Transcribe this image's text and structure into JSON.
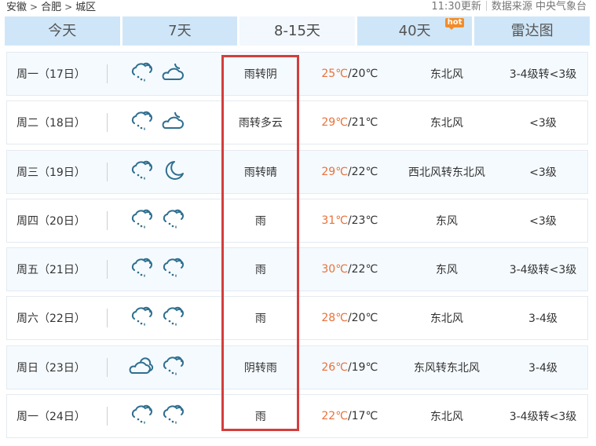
{
  "breadcrumb": {
    "items": [
      "安徽",
      "合肥",
      "城区"
    ],
    "separator": ">"
  },
  "meta": {
    "update_time": "11:30更新",
    "source": "数据来源 中央气象台"
  },
  "tabs": [
    {
      "label": "今天",
      "active": false
    },
    {
      "label": "7天",
      "active": false
    },
    {
      "label": "8-15天",
      "active": true
    },
    {
      "label": "40天",
      "active": false,
      "badge": "hot"
    },
    {
      "label": "雷达图",
      "active": false
    }
  ],
  "colors": {
    "tab_bg": "#cfe6f8",
    "tab_active_bg": "#f2f8fd",
    "high_temp": "#e8713a",
    "icon": "#2f6f8f",
    "hot_badge": "#f28c2a",
    "highlight_box": "#d43d3d"
  },
  "forecast": [
    {
      "date": "周一（17日）",
      "icon_day": "rain-icon",
      "icon_night": "cloudy-night-icon",
      "weather": "雨转阴",
      "high": "25℃",
      "low": "/20℃",
      "wind": "东北风",
      "level": "3-4级转<3级"
    },
    {
      "date": "周二（18日）",
      "icon_day": "rain-icon",
      "icon_night": "cloudy-night-icon",
      "weather": "雨转多云",
      "high": "29℃",
      "low": "/21℃",
      "wind": "东北风",
      "level": "<3级"
    },
    {
      "date": "周三（19日）",
      "icon_day": "rain-icon",
      "icon_night": "moon-icon",
      "weather": "雨转晴",
      "high": "29℃",
      "low": "/22℃",
      "wind": "西北风转东北风",
      "level": "<3级"
    },
    {
      "date": "周四（20日）",
      "icon_day": "rain-icon",
      "icon_night": "rain-icon",
      "weather": "雨",
      "high": "31℃",
      "low": "/23℃",
      "wind": "东风",
      "level": "<3级"
    },
    {
      "date": "周五（21日）",
      "icon_day": "rain-icon",
      "icon_night": "rain-icon",
      "weather": "雨",
      "high": "30℃",
      "low": "/22℃",
      "wind": "东风",
      "level": "3-4级转<3级"
    },
    {
      "date": "周六（22日）",
      "icon_day": "rain-icon",
      "icon_night": "rain-icon",
      "weather": "雨",
      "high": "28℃",
      "low": "/20℃",
      "wind": "东北风",
      "level": "3-4级"
    },
    {
      "date": "周日（23日）",
      "icon_day": "overcast-icon",
      "icon_night": "rain-icon",
      "weather": "阴转雨",
      "high": "26℃",
      "low": "/19℃",
      "wind": "东风转东北风",
      "level": "3-4级"
    },
    {
      "date": "周一（24日）",
      "icon_day": "rain-icon",
      "icon_night": "rain-icon",
      "weather": "雨",
      "high": "22℃",
      "low": "/17℃",
      "wind": "东北风",
      "level": "3-4级转<3级"
    }
  ]
}
